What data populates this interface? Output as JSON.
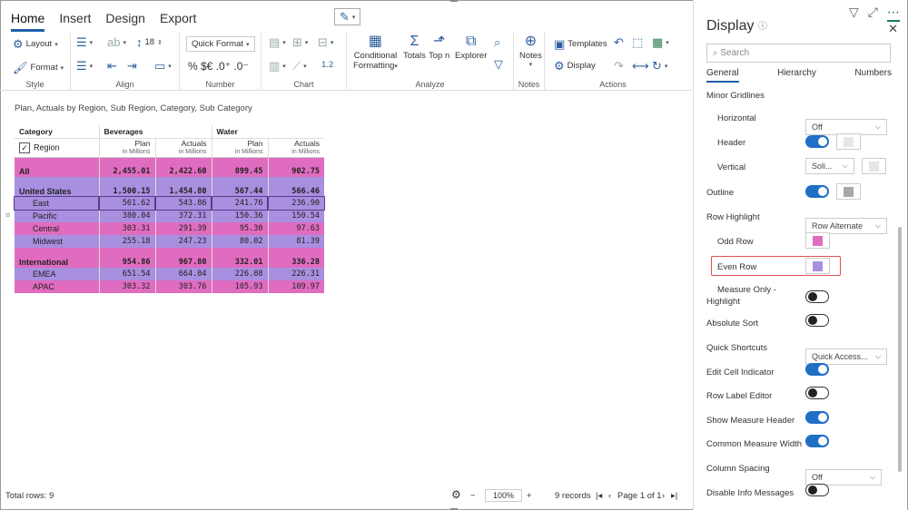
{
  "ribbon": {
    "tabs": [
      "Home",
      "Insert",
      "Design",
      "Export"
    ],
    "style": {
      "layout": "Layout",
      "format": "Format",
      "label": "Style"
    },
    "align": {
      "font_size": "18",
      "label": "Align"
    },
    "number": {
      "quick_format": "Quick Format",
      "symbols": "% $€ .0⁺ .0⁻",
      "label": "Number"
    },
    "chart": {
      "scale": "1.2",
      "label": "Chart"
    },
    "analyze": {
      "conditional": "Conditional",
      "formatting": "Formatting",
      "totals": "Totals",
      "topn": "Top n",
      "explorer": "Explorer",
      "label": "Analyze"
    },
    "notes": {
      "notes": "Notes",
      "label": "Notes"
    },
    "actions": {
      "templates": "Templates",
      "display": "Display",
      "label": "Actions"
    }
  },
  "report": {
    "subtitle": "Plan, Actuals by Region, Sub Region, Category, Sub Category",
    "category_header": "Category",
    "region_header": "Region",
    "groups": [
      "Beverages",
      "Water"
    ],
    "measures": [
      {
        "name": "Plan",
        "unit": "in Millions"
      },
      {
        "name": "Actuals",
        "unit": "in Millions"
      },
      {
        "name": "Plan",
        "unit": "in Millions"
      },
      {
        "name": "Actuals",
        "unit": "in Millions"
      }
    ],
    "rows": [
      {
        "label": "All",
        "values": [
          "2,455.01",
          "2,422.60",
          "899.45",
          "902.75"
        ],
        "bold": true,
        "indent": false,
        "shade": "odd"
      },
      {
        "label": "United States",
        "values": [
          "1,500.15",
          "1,454.80",
          "567.44",
          "566.46"
        ],
        "bold": true,
        "indent": false,
        "shade": "even"
      },
      {
        "label": "East",
        "values": [
          "561.62",
          "543.86",
          "241.76",
          "236.90"
        ],
        "bold": false,
        "indent": true,
        "shade": "even"
      },
      {
        "label": "Pacific",
        "values": [
          "380.04",
          "372.31",
          "150.36",
          "150.54"
        ],
        "bold": false,
        "indent": true,
        "shade": "even"
      },
      {
        "label": "Central",
        "values": [
          "303.31",
          "291.39",
          "95.30",
          "97.63"
        ],
        "bold": false,
        "indent": true,
        "shade": "odd"
      },
      {
        "label": "Midwest",
        "values": [
          "255.18",
          "247.23",
          "80.02",
          "81.39"
        ],
        "bold": false,
        "indent": true,
        "shade": "even"
      },
      {
        "label": "International",
        "values": [
          "954.86",
          "967.80",
          "332.01",
          "336.28"
        ],
        "bold": true,
        "indent": false,
        "shade": "odd"
      },
      {
        "label": "EMEA",
        "values": [
          "651.54",
          "664.04",
          "226.08",
          "226.31"
        ],
        "bold": false,
        "indent": true,
        "shade": "even"
      },
      {
        "label": "APAC",
        "values": [
          "303.32",
          "303.76",
          "105.93",
          "109.97"
        ],
        "bold": false,
        "indent": true,
        "shade": "odd"
      }
    ]
  },
  "status": {
    "total_rows": "Total rows: 9",
    "zoom": "100%",
    "records": "9 records",
    "page": "Page 1 of 1"
  },
  "panel": {
    "title": "Display",
    "search_placeholder": "Search",
    "tabs": [
      "General",
      "Hierarchy",
      "Numbers"
    ],
    "section": "Minor Gridlines",
    "settings": {
      "horizontal": {
        "label": "Horizontal",
        "value": "Off"
      },
      "header": {
        "label": "Header"
      },
      "vertical": {
        "label": "Vertical",
        "value": "Soli..."
      },
      "outline": {
        "label": "Outline"
      },
      "row_highlight": {
        "label": "Row Highlight",
        "value": "Row Alternate"
      },
      "odd_row": {
        "label": "Odd Row"
      },
      "even_row": {
        "label": "Even Row"
      },
      "measure_only": {
        "label": "Measure Only - Highlight"
      },
      "absolute_sort": {
        "label": "Absolute Sort"
      },
      "quick_shortcuts": {
        "label": "Quick Shortcuts",
        "value": "Quick Access..."
      },
      "edit_cell": {
        "label": "Edit Cell Indicator"
      },
      "row_label_editor": {
        "label": "Row Label Editor"
      },
      "show_measure_header": {
        "label": "Show Measure Header"
      },
      "common_measure_width": {
        "label": "Common Measure Width"
      },
      "column_spacing": {
        "label": "Column Spacing",
        "value": "Off"
      },
      "disable_info": {
        "label": "Disable Info Messages"
      }
    }
  },
  "colors": {
    "odd_row": "#e06cc0",
    "even_row": "#a88fe0",
    "accent": "#1f6fc5",
    "gridline_swatch": "#e6e6e6",
    "outline_swatch": "#a8a8a8"
  }
}
